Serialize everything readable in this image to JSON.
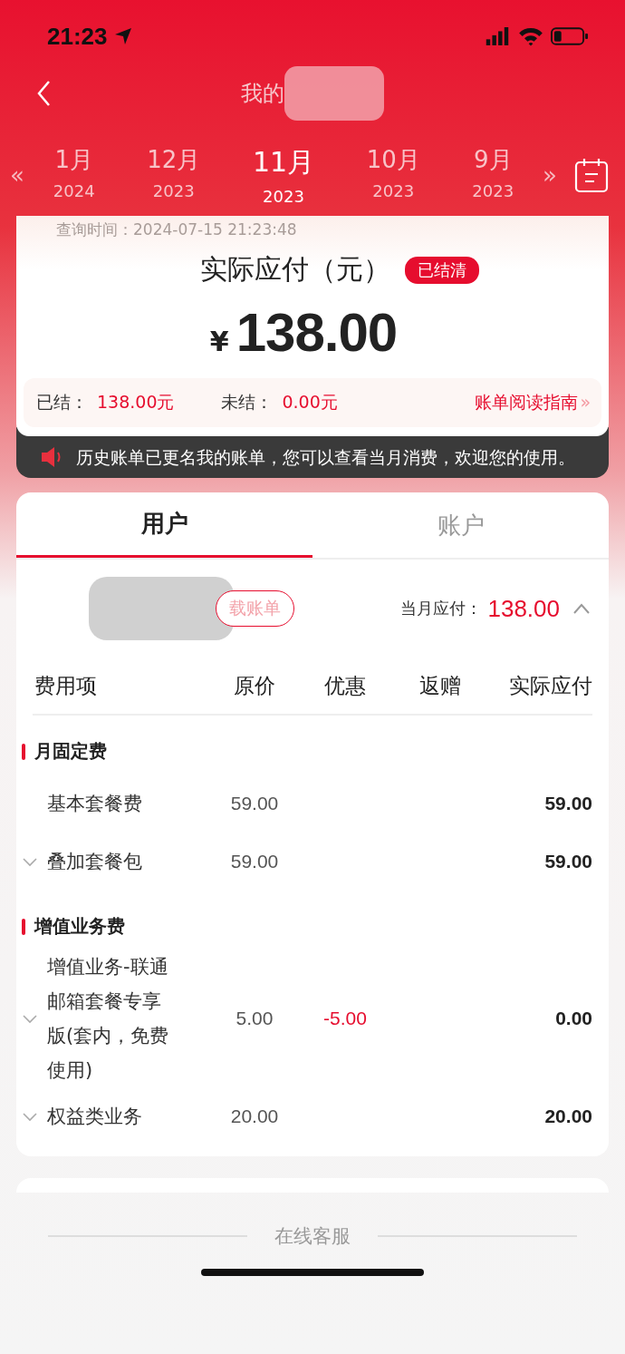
{
  "status_bar": {
    "time": "21:23"
  },
  "header": {
    "title": "我的"
  },
  "months": [
    {
      "month": "1月",
      "year": "2024",
      "selected": false
    },
    {
      "month": "12月",
      "year": "2023",
      "selected": false
    },
    {
      "month": "11月",
      "year": "2023",
      "selected": true
    },
    {
      "month": "10月",
      "year": "2023",
      "selected": false
    },
    {
      "month": "9月",
      "year": "2023",
      "selected": false
    }
  ],
  "month_nav": {
    "prev": "«",
    "next": "»"
  },
  "summary": {
    "query_time": "查询时间：2024-07-15 21:23:48",
    "title": "实际应付（元）",
    "badge": "已结清",
    "currency": "¥",
    "amount": "138.00",
    "settled_label": "已结：",
    "settled_value": "138.00元",
    "unsettled_label": "未结：",
    "unsettled_value": "0.00元",
    "guide_link": "账单阅读指南",
    "guide_arrow": "»"
  },
  "notice": {
    "text": "历史账单已更名我的账单，您可以查看当月消费，欢迎您的使用。"
  },
  "tabs": [
    {
      "label": "用户",
      "selected": true
    },
    {
      "label": "账户",
      "selected": false
    }
  ],
  "bill": {
    "download_button": "载账单",
    "monthly_label": "当月应付：",
    "monthly_value": "138.00",
    "expanded": true,
    "columns": [
      "费用项",
      "原价",
      "优惠",
      "返赠",
      "实际应付"
    ],
    "sections": [
      {
        "title": "月固定费",
        "rows": [
          {
            "name": "基本套餐费",
            "original": "59.00",
            "discount": "",
            "rebate": "",
            "actual": "59.00",
            "expandable": false
          },
          {
            "name": "叠加套餐包",
            "original": "59.00",
            "discount": "",
            "rebate": "",
            "actual": "59.00",
            "expandable": true
          }
        ]
      },
      {
        "title": "增值业务费",
        "rows": [
          {
            "name": "增值业务-联通邮箱套餐专享版(套内，免费使用)",
            "original": "5.00",
            "discount": "-5.00",
            "rebate": "",
            "actual": "0.00",
            "expandable": true
          },
          {
            "name": "权益类业务",
            "original": "20.00",
            "discount": "",
            "rebate": "",
            "actual": "20.00",
            "expandable": true
          }
        ]
      }
    ]
  },
  "footer": {
    "service_link": "在线客服"
  }
}
